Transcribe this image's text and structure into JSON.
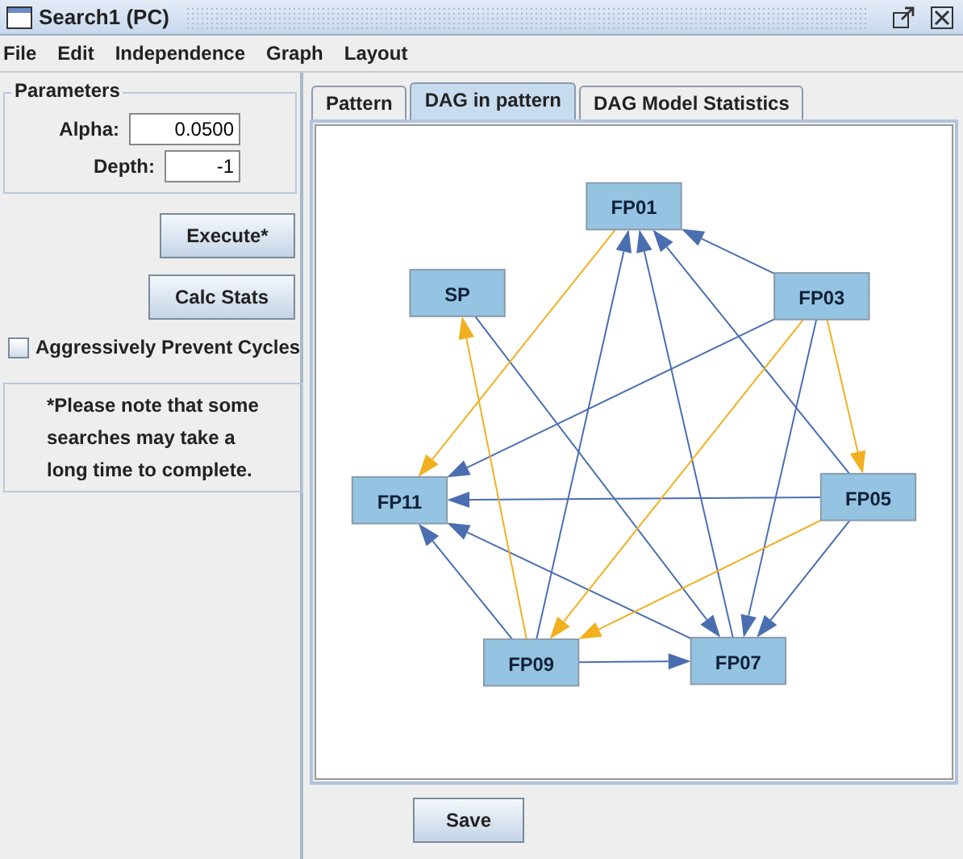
{
  "window": {
    "title": "Search1 (PC)"
  },
  "menu": [
    "File",
    "Edit",
    "Independence",
    "Graph",
    "Layout"
  ],
  "parameters": {
    "title": "Parameters",
    "fields": [
      {
        "label": "Alpha:",
        "value": "0.0500"
      },
      {
        "label": "Depth:",
        "value": "-1"
      }
    ]
  },
  "buttons": [
    "Execute*",
    "Calc Stats"
  ],
  "aggressive_cycles": {
    "label": "Aggressively Prevent Cycles",
    "checked": false
  },
  "note": "*Please note that some searches may take a long time to complete.",
  "tabs": [
    {
      "label": "Pattern",
      "selected": false
    },
    {
      "label": "DAG in pattern",
      "selected": true
    },
    {
      "label": "DAG Model Statistics",
      "selected": false
    }
  ],
  "graph": {
    "nodes": [
      "FP01",
      "SP",
      "FP03",
      "FP11",
      "FP05",
      "FP09",
      "FP07"
    ],
    "edges": [
      {
        "color": "#4a6eb0"
      },
      {
        "color": "#4a6eb0"
      },
      {
        "color": "#4a6eb0"
      },
      {
        "color": "#4a6eb0"
      },
      {
        "color": "#4a6eb0"
      },
      {
        "color": "#4a6eb0"
      },
      {
        "color": "#4a6eb0"
      },
      {
        "color": "#4a6eb0"
      },
      {
        "color": "#4a6eb0"
      },
      {
        "color": "#4a6eb0"
      },
      {
        "color": "#4a6eb0"
      },
      {
        "color": "#4a6eb0"
      },
      {
        "color": "#f0b020"
      },
      {
        "color": "#f0b020"
      },
      {
        "color": "#f0b020"
      },
      {
        "color": "#f0b020"
      },
      {
        "color": "#f0b020"
      }
    ]
  },
  "save_button": "Save"
}
